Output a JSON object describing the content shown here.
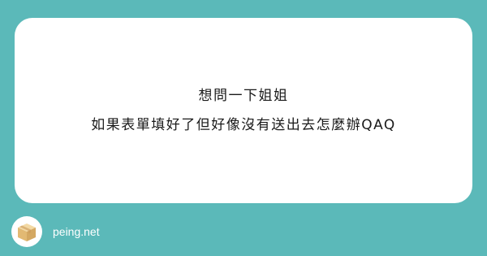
{
  "question": {
    "line1": "想問一下姐姐",
    "line2": "如果表單填好了但好像沒有送出去怎麼辦QAQ"
  },
  "footer": {
    "site_name": "peing.net",
    "logo_icon": "cardboard-box-icon"
  },
  "colors": {
    "background": "#5bb9b9",
    "card": "#ffffff",
    "text": "#1a1a1a",
    "footer_text": "#ffffff",
    "box_light": "#e9c98b",
    "box_dark": "#d4a862"
  }
}
